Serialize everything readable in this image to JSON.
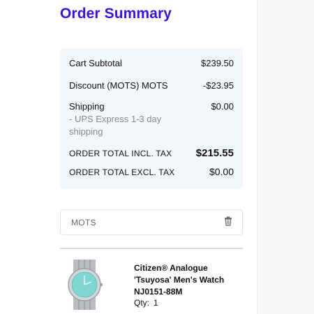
{
  "page": {
    "title": "Order Summary"
  },
  "summary": {
    "cart_subtotal_label": "Cart Subtotal",
    "cart_subtotal_value": "$239.50",
    "discount_label": "Discount (MOTS) MOTS",
    "discount_value": "-$23.95",
    "shipping_label": "Shipping",
    "shipping_method": "- UPS Express 1-3 day shipping",
    "shipping_value": "$0.00",
    "total_incl_label": "ORDER TOTAL INCL. TAX",
    "total_incl_value": "$215.55",
    "total_excl_label": "ORDER TOTAL EXCL. TAX",
    "total_excl_value": "$0.00"
  },
  "coupon": {
    "code": "MOTS",
    "remove_icon": "trash-icon"
  },
  "product": {
    "name": "Citizen® Analogue 'Tsuyosa' Men's Watch NJ0151-88M",
    "qty_label": "Qty:",
    "qty_value": "1",
    "image": "watch-image"
  },
  "colors": {
    "title": "#3b10e0",
    "summary_bg": "#f3f6fa",
    "muted_text": "#888888",
    "dial": "#7fd6d0"
  }
}
